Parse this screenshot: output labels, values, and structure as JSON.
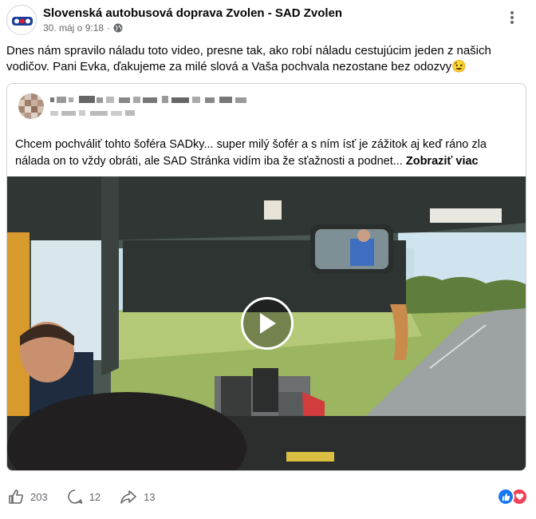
{
  "page": {
    "name": "Slovenská autobusová doprava Zvolen - SAD Zvolen",
    "date": "30. máj o 9:18",
    "separator": "·"
  },
  "post": {
    "text": "Dnes nám spravilo náladu toto video, presne tak, ako robí náladu cestujúcim jeden z našich vodičov. Pani Evka, ďakujeme za milé slová a Vaša pochvala nezostane bez odozvy",
    "emoji": "😉"
  },
  "shared": {
    "text": "Chcem pochváliť tohto šoféra SADky... super milý šofér a s ním ísť je zážitok aj keď ráno zla nálada on to vždy obráti,  ale SAD Stránka vidím iba že sťažnosti a podnet...",
    "see_more": "Zobraziť viac"
  },
  "actions": {
    "likes": "203",
    "comments": "12",
    "shares": "13"
  },
  "icons": [
    "logo-icon",
    "globe-icon",
    "more-icon",
    "play-icon",
    "like-icon",
    "comment-icon",
    "share-icon",
    "like-reaction-icon",
    "love-reaction-icon"
  ],
  "colors": {
    "meta_text": "#65676b",
    "like_blue": "#1877f2",
    "love_red": "#f33e58"
  }
}
